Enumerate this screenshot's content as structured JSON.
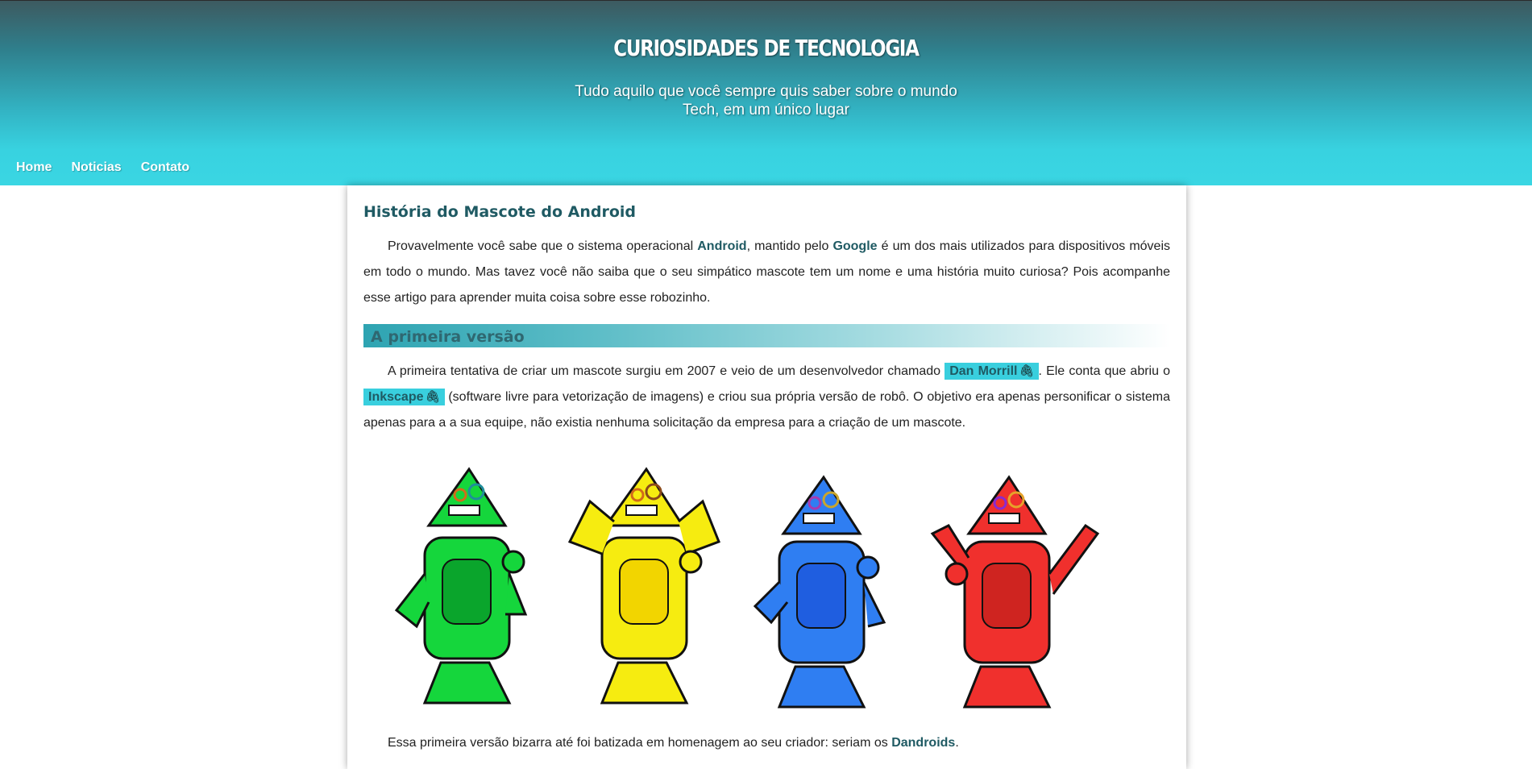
{
  "header": {
    "title": "CURIOSIDADES DE TECNOLOGIA",
    "subtitle_line1": "Tudo aquilo que você sempre quis saber sobre o mundo",
    "subtitle_line2": "Tech, em um único lugar"
  },
  "nav": {
    "items": [
      {
        "label": "Home"
      },
      {
        "label": "Noticias"
      },
      {
        "label": "Contato"
      }
    ]
  },
  "article": {
    "title": "História do Mascote do Android",
    "intro": {
      "t1": "Provavelmente você sabe que o sistema operacional ",
      "android": "Android",
      "t2": ", mantido pelo ",
      "google": "Google",
      "t3": " é um dos mais utilizados para dispositivos móveis em todo o mundo. Mas tavez você não saiba que o seu simpático mascote tem um nome e uma história muito curiosa? Pois acompanhe esse artigo para aprender muita coisa sobre esse robozinho."
    },
    "section1": {
      "heading": "A primeira versão",
      "t1": "A primeira tentativa de criar um mascote surgiu em 2007 e veio de um desenvolvedor chamado ",
      "link_dan": "Dan Morrill",
      "t2": ". Ele conta que abriu o ",
      "link_inkscape": "Inkscape",
      "t3": " (software livre para vetorização de imagens) e criou sua própria versão de robô. O objetivo era apenas personificar o sistema apenas para a a sua equipe, não existia nenhuma solicitação da empresa para a criação de um mascote.",
      "last_t1": "Essa primeira versão bizarra até foi batizada em homenagem ao seu criador: seriam os ",
      "dandroids": "Dandroids",
      "last_t2": "."
    },
    "image": {
      "robot_colors": [
        "#15d63c",
        "#f6ec10",
        "#2f7ef2",
        "#f0302d"
      ]
    }
  },
  "icons": {
    "link": "paperclip-icon"
  },
  "colors": {
    "accent": "#39cfde",
    "heading_text": "#1f5a63"
  }
}
